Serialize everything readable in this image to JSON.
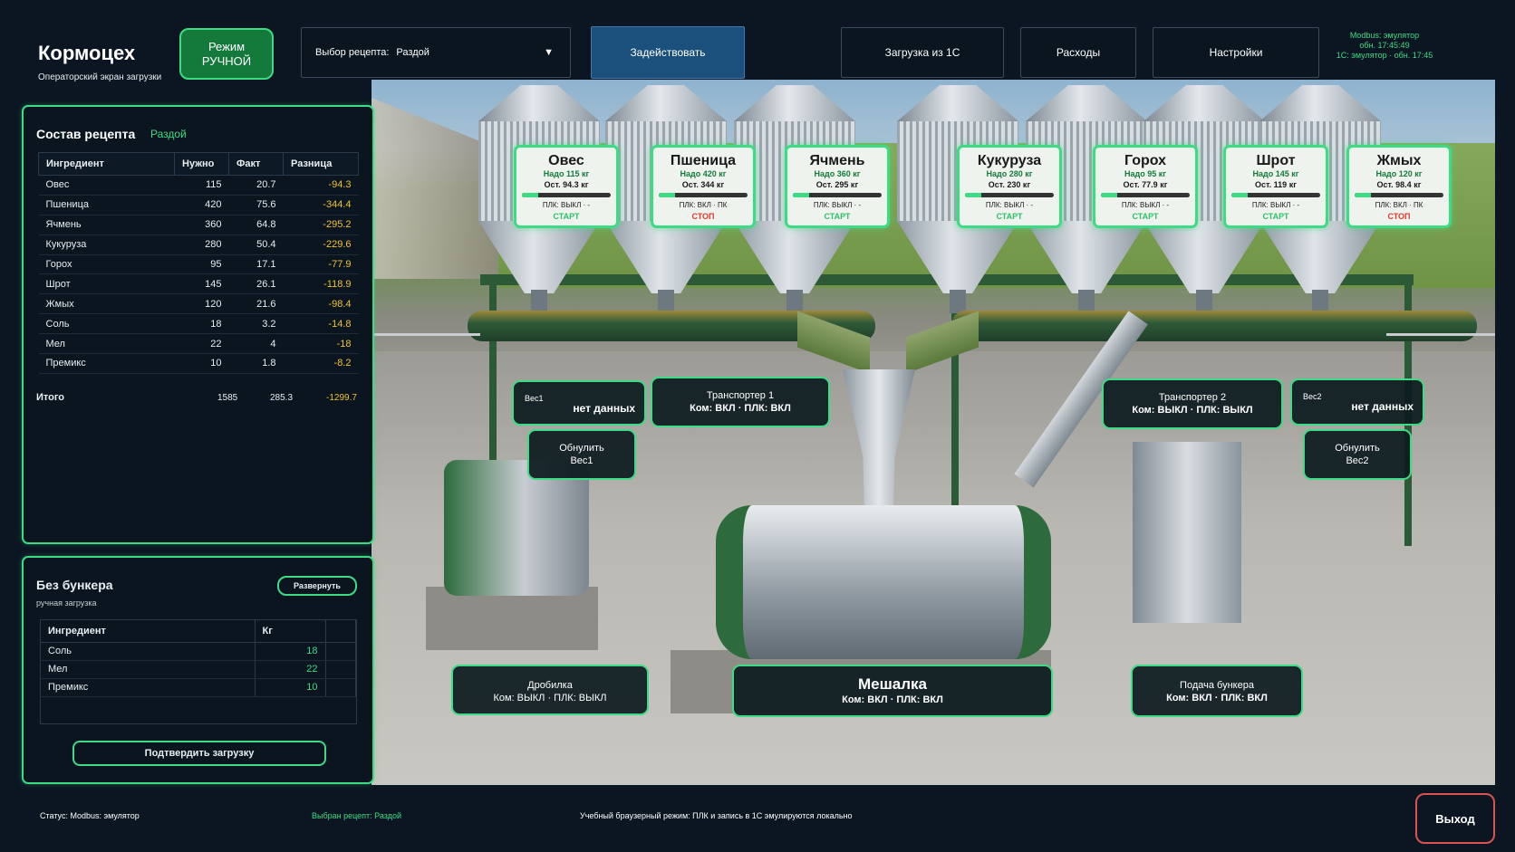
{
  "header": {
    "title": "Кормоцех",
    "subtitle": "Операторский экран загрузки",
    "mode_line1": "Режим",
    "mode_line2": "РУЧНОЙ",
    "recipe_label": "Выбор рецепта:",
    "recipe_value": "Раздой",
    "recipe_arrow": "▼",
    "apply": "Задействовать",
    "load_1c": "Загрузка из 1С",
    "expenses": "Расходы",
    "settings": "Настройки",
    "status_line1": "Modbus: эмулятор",
    "status_line2": "обн. 17:45:49",
    "status_line3": "1С: эмулятор · обн. 17:45"
  },
  "silos": [
    {
      "name": "Овес",
      "need": "Надо 115 кг",
      "rest": "Ост. 94.3 кг",
      "progress": 0.18,
      "plc": "ПЛК: ВЫКЛ · -",
      "action": "СТАРТ",
      "action_type": "start"
    },
    {
      "name": "Пшеница",
      "need": "Надо 420 кг",
      "rest": "Ост. 344 кг",
      "progress": 0.18,
      "plc": "ПЛК: ВКЛ · ПК",
      "action": "СТОП",
      "action_type": "stop"
    },
    {
      "name": "Ячмень",
      "need": "Надо 360 кг",
      "rest": "Ост. 295 кг",
      "progress": 0.18,
      "plc": "ПЛК: ВЫКЛ · -",
      "action": "СТАРТ",
      "action_type": "start"
    },
    {
      "name": "Кукуруза",
      "need": "Надо 280 кг",
      "rest": "Ост. 230 кг",
      "progress": 0.18,
      "plc": "ПЛК: ВЫКЛ · -",
      "action": "СТАРТ",
      "action_type": "start"
    },
    {
      "name": "Горох",
      "need": "Надо 95 кг",
      "rest": "Ост. 77.9 кг",
      "progress": 0.18,
      "plc": "ПЛК: ВЫКЛ · -",
      "action": "СТАРТ",
      "action_type": "start"
    },
    {
      "name": "Шрот",
      "need": "Надо 145 кг",
      "rest": "Ост. 119 кг",
      "progress": 0.18,
      "plc": "ПЛК: ВЫКЛ · -",
      "action": "СТАРТ",
      "action_type": "start"
    },
    {
      "name": "Жмых",
      "need": "Надо 120 кг",
      "rest": "Ост. 98.4 кг",
      "progress": 0.18,
      "plc": "ПЛК: ВКЛ · ПК",
      "action": "СТОП",
      "action_type": "stop"
    }
  ],
  "scene": {
    "scale1_label": "Вес1",
    "scale1_value": "нет данных",
    "scale2_label": "Вес2",
    "scale2_value": "нет данных",
    "reset1_line1": "Обнулить",
    "reset1_line2": "Вес1",
    "reset2_line1": "Обнулить",
    "reset2_line2": "Вес2",
    "conveyor1_title": "Транспортер 1",
    "conveyor1_state": "Ком: ВКЛ · ПЛК: ВКЛ",
    "conveyor2_title": "Транспортер 2",
    "conveyor2_state": "Ком: ВЫКЛ · ПЛК: ВЫКЛ",
    "crusher_title": "Дробилка",
    "crusher_state": "Ком: ВЫКЛ · ПЛК: ВЫКЛ",
    "mixer_title": "Мешалка",
    "mixer_state": "Ком: ВКЛ · ПЛК: ВКЛ",
    "feeder_title": "Подача бункера",
    "feeder_state": "Ком: ВКЛ · ПЛК: ВКЛ"
  },
  "recipe_panel": {
    "title": "Состав рецепта",
    "recipe_name": "Раздой",
    "columns": [
      "Ингредиент",
      "Нужно",
      "Факт",
      "Разница"
    ],
    "rows": [
      [
        "Овес",
        "115",
        "20.7",
        "-94.3"
      ],
      [
        "Пшеница",
        "420",
        "75.6",
        "-344.4"
      ],
      [
        "Ячмень",
        "360",
        "64.8",
        "-295.2"
      ],
      [
        "Кукуруза",
        "280",
        "50.4",
        "-229.6"
      ],
      [
        "Горох",
        "95",
        "17.1",
        "-77.9"
      ],
      [
        "Шрот",
        "145",
        "26.1",
        "-118.9"
      ],
      [
        "Жмых",
        "120",
        "21.6",
        "-98.4"
      ],
      [
        "Соль",
        "18",
        "3.2",
        "-14.8"
      ],
      [
        "Мел",
        "22",
        "4",
        "-18"
      ],
      [
        "Премикс",
        "10",
        "1.8",
        "-8.2"
      ]
    ],
    "total_label": "Итого",
    "total_need": "1585",
    "total_fact": "285.3",
    "total_diff": "-1299.7"
  },
  "bunker_panel": {
    "title": "Без бункера",
    "subtitle": "ручная загрузка",
    "expand": "Развернуть",
    "columns": [
      "Ингредиент",
      "Кг"
    ],
    "rows": [
      [
        "Соль",
        "18"
      ],
      [
        "Мел",
        "22"
      ],
      [
        "Премикс",
        "10"
      ]
    ],
    "confirm": "Подтвердить загрузку"
  },
  "footer": {
    "status": "Статус: Modbus: эмулятор",
    "selected": "Выбран рецепт: Раздой",
    "note": "Учебный браузерный режим: ПЛК и запись в 1С эмулируются локально",
    "exit": "Выход"
  },
  "colors": {
    "accent": "#3ddc84",
    "background": "#0b1622",
    "warning": "#f2c230",
    "stop": "#e0392a",
    "apply": "#1b4f7c",
    "exit_border": "#d9534f"
  }
}
